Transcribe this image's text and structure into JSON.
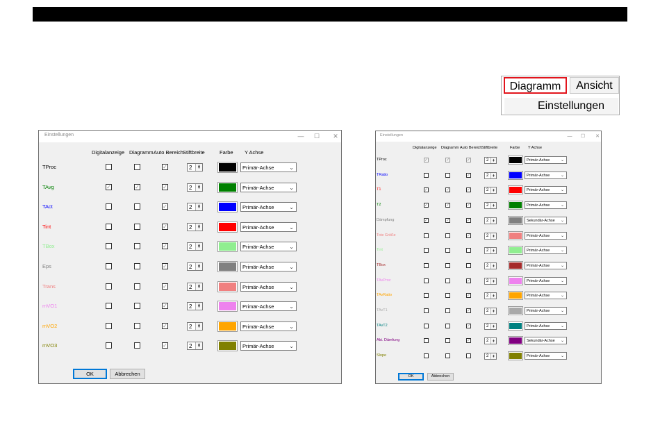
{
  "ribbon": {
    "tab_diagramm": "Diagramm",
    "tab_ansicht": "Ansicht",
    "group_einstellungen": "Einstellungen",
    "highlight_color": "#e2141c"
  },
  "dialog_large": {
    "title": "Einstellungen",
    "window_controls": {
      "minimize": "—",
      "maximize": "☐",
      "close": "✕"
    },
    "headers": {
      "digital": "Digitalanzeige",
      "diagramm": "Diagramm",
      "auto": "Auto Bereich",
      "stift": "Stiftbreite",
      "farbe": "Farbe",
      "yachse": "Y Achse"
    },
    "rows": [
      {
        "name": "TProc",
        "name_color": "#000000",
        "digital": false,
        "diagramm": false,
        "auto": true,
        "stift": "2",
        "color": "#000000",
        "yachse": "Primär-Achse"
      },
      {
        "name": "TAvg",
        "name_color": "#008000",
        "digital": true,
        "diagramm": true,
        "auto": true,
        "stift": "2",
        "color": "#008000",
        "yachse": "Primär-Achse"
      },
      {
        "name": "TAct",
        "name_color": "#0000ff",
        "digital": false,
        "diagramm": false,
        "auto": true,
        "stift": "2",
        "color": "#0000ff",
        "yachse": "Primär-Achse"
      },
      {
        "name": "Tint",
        "name_color": "#ff0000",
        "digital": false,
        "diagramm": false,
        "auto": true,
        "stift": "2",
        "color": "#ff0000",
        "yachse": "Primär-Achse"
      },
      {
        "name": "TBox",
        "name_color": "#90ee90",
        "digital": false,
        "diagramm": false,
        "auto": true,
        "stift": "2",
        "color": "#90ee90",
        "yachse": "Primär-Achse"
      },
      {
        "name": "Eps",
        "name_color": "#808080",
        "digital": false,
        "diagramm": false,
        "auto": true,
        "stift": "2",
        "color": "#808080",
        "yachse": "Primär-Achse"
      },
      {
        "name": "Trans",
        "name_color": "#f08080",
        "digital": false,
        "diagramm": false,
        "auto": true,
        "stift": "2",
        "color": "#f08080",
        "yachse": "Primär-Achse"
      },
      {
        "name": "mVO1",
        "name_color": "#ee82ee",
        "digital": false,
        "diagramm": false,
        "auto": true,
        "stift": "2",
        "color": "#ee82ee",
        "yachse": "Primär-Achse"
      },
      {
        "name": "mVO2",
        "name_color": "#ffa500",
        "digital": false,
        "diagramm": false,
        "auto": true,
        "stift": "2",
        "color": "#ffa500",
        "yachse": "Primär-Achse"
      },
      {
        "name": "mVO3",
        "name_color": "#808000",
        "digital": false,
        "diagramm": false,
        "auto": true,
        "stift": "2",
        "color": "#808000",
        "yachse": "Primär-Achse"
      }
    ],
    "ok_label": "OK",
    "cancel_label": "Abbrechen"
  },
  "dialog_small": {
    "title": "Einstellungen",
    "window_controls": {
      "minimize": "—",
      "maximize": "☐",
      "close": "✕"
    },
    "headers": {
      "digital": "Digitalanzeige",
      "diagramm": "Diagramm",
      "auto": "Auto Bereich",
      "stift": "Stiftbreite",
      "farbe": "Farbe",
      "yachse": "Y Achse"
    },
    "rows": [
      {
        "name": "TProc",
        "name_color": "#000000",
        "digital": true,
        "diagramm": true,
        "auto": true,
        "disabled": true,
        "stift": "2",
        "color": "#000000",
        "yachse": "Primär-Achse"
      },
      {
        "name": "TRatio",
        "name_color": "#0000ff",
        "digital": false,
        "diagramm": false,
        "auto": true,
        "disabled": false,
        "stift": "2",
        "color": "#0000ff",
        "yachse": "Primär-Achse"
      },
      {
        "name": "T1",
        "name_color": "#ff0000",
        "digital": true,
        "diagramm": true,
        "auto": true,
        "disabled": false,
        "stift": "2",
        "color": "#ff0000",
        "yachse": "Primär-Achse"
      },
      {
        "name": "T2",
        "name_color": "#008000",
        "digital": true,
        "diagramm": true,
        "auto": true,
        "disabled": false,
        "stift": "2",
        "color": "#008000",
        "yachse": "Primär-Achse"
      },
      {
        "name": "Dämpfung",
        "name_color": "#808080",
        "digital": true,
        "diagramm": true,
        "auto": true,
        "disabled": false,
        "stift": "2",
        "color": "#808080",
        "yachse": "Sekundär-Achse"
      },
      {
        "name": "Tote Größe",
        "name_color": "#f08080",
        "digital": false,
        "diagramm": false,
        "auto": true,
        "disabled": false,
        "stift": "2",
        "color": "#f08080",
        "yachse": "Primär-Achse"
      },
      {
        "name": "Tint",
        "name_color": "#90ee90",
        "digital": false,
        "diagramm": false,
        "auto": false,
        "disabled": false,
        "stift": "2",
        "color": "#90ee90",
        "yachse": "Primär-Achse"
      },
      {
        "name": "TBox",
        "name_color": "#a52a2a",
        "digital": false,
        "diagramm": false,
        "auto": false,
        "disabled": false,
        "stift": "2",
        "color": "#a52a2a",
        "yachse": "Primär-Achse"
      },
      {
        "name": "TAvProc",
        "name_color": "#ee82ee",
        "digital": false,
        "diagramm": false,
        "auto": true,
        "disabled": false,
        "stift": "2",
        "color": "#ee82ee",
        "yachse": "Primär-Achse"
      },
      {
        "name": "TAvRatio",
        "name_color": "#ffa500",
        "digital": false,
        "diagramm": false,
        "auto": true,
        "disabled": false,
        "stift": "2",
        "color": "#ffa500",
        "yachse": "Primär-Achse"
      },
      {
        "name": "TAvT1",
        "name_color": "#a9a9a9",
        "digital": false,
        "diagramm": false,
        "auto": true,
        "disabled": false,
        "stift": "2",
        "color": "#a9a9a9",
        "yachse": "Primär-Achse"
      },
      {
        "name": "TAvT2",
        "name_color": "#008080",
        "digital": false,
        "diagramm": false,
        "auto": true,
        "disabled": false,
        "stift": "2",
        "color": "#008080",
        "yachse": "Primär-Achse"
      },
      {
        "name": "Akt. Dämfung",
        "name_color": "#800080",
        "digital": false,
        "diagramm": false,
        "auto": true,
        "disabled": false,
        "stift": "2",
        "color": "#800080",
        "yachse": "Sekundär-Achse"
      },
      {
        "name": "Slope",
        "name_color": "#808000",
        "digital": false,
        "diagramm": false,
        "auto": false,
        "disabled": false,
        "stift": "2",
        "color": "#808000",
        "yachse": "Primär-Achse"
      }
    ],
    "ok_label": "OK",
    "cancel_label": "Abbrechen"
  }
}
